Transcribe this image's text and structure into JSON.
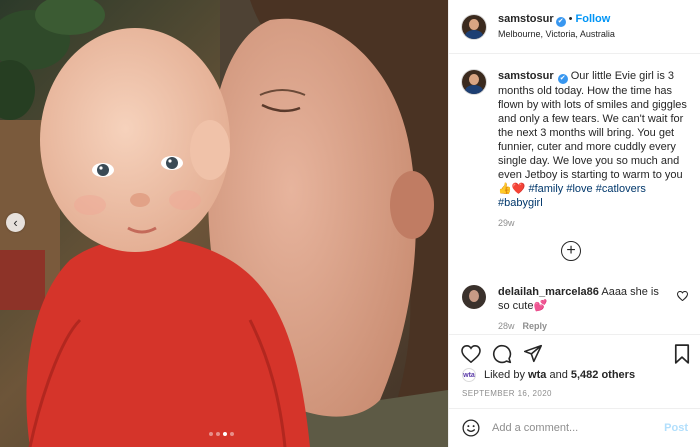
{
  "header": {
    "username": "samstosur",
    "verified_mark": "✔",
    "separator": "•",
    "follow_label": "Follow",
    "location": "Melbourne, Victoria, Australia"
  },
  "caption": {
    "username": "samstosur",
    "text": "Our little Evie girl is 3 months old today. How the time has flown by with lots of smiles and giggles and only a few tears. We can't wait for the next 3 months will bring. You get funnier, cuter and more cuddly every single day. We love you so much and even Jetboy is starting to warm to you 👍❤️",
    "hashtags": [
      "#family",
      "#love",
      "#catlovers",
      "#babygirl"
    ],
    "age": "29w"
  },
  "load_more_label": "+",
  "comment": {
    "username": "delailah_marcela86",
    "text": "Aaaa she is so cute💕",
    "age": "28w",
    "reply_label": "Reply"
  },
  "likes": {
    "prefix": "Liked by",
    "user": "wta",
    "conjunction": "and",
    "others": "5,482 others",
    "avatar_text": "wta"
  },
  "date": "SEPTEMBER 16, 2020",
  "add_comment": {
    "placeholder": "Add a comment...",
    "post_label": "Post"
  },
  "media": {
    "prev_arrow": "‹",
    "slide_count": 4,
    "active_slide": 3
  },
  "colors": {
    "accent": "#0095f6",
    "verified": "#3897f0",
    "hashtag": "#00376b",
    "muted": "#8e8e8e",
    "post_disabled": "#b2dffc"
  }
}
